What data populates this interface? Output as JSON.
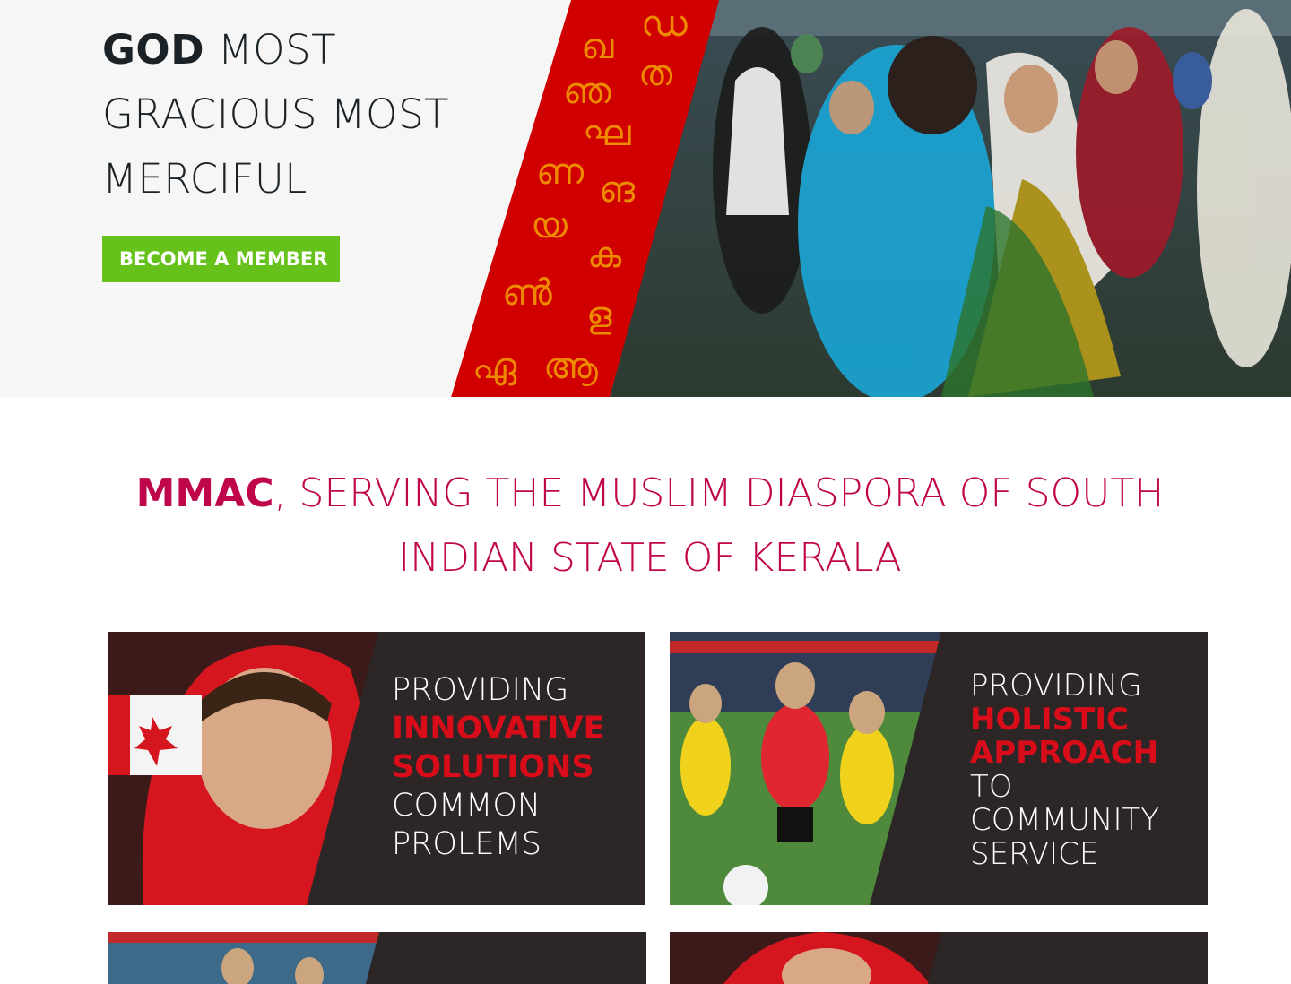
{
  "hero": {
    "title_bold": "GOD",
    "title_rest": " MOST GRACIOUS MOST MERCIFUL",
    "member_button": "BECOME A MEMBER",
    "malayalam_glyphs": [
      "ഖ",
      "ഡ",
      "ഞ",
      "ത",
      "ഘ",
      "ണ",
      "ങ",
      "യ",
      "ക",
      "ൺ",
      "ള",
      "ഏ",
      "ആ"
    ],
    "colors": {
      "banner_red": "#d00000",
      "glyph": "#ee8a00",
      "button_green": "#66c21a"
    }
  },
  "tagline": {
    "bold": "MMAC",
    "rest": ", SERVING THE MUSLIM DIASPORA OF  SOUTH INDIAN STATE OF KERALA"
  },
  "cards": [
    {
      "line1": "PROVIDING",
      "highlight1": "INNOVATIVE",
      "highlight2": "SOLUTIONS",
      "line4": "COMMON",
      "line5": "PROLEMS"
    },
    {
      "line1": "PROVIDING",
      "highlight1": "HOLISTIC",
      "highlight2": "APPROACH",
      "line4": "TO",
      "line5": "COMMUNITY",
      "line6": "SERVICE"
    }
  ]
}
